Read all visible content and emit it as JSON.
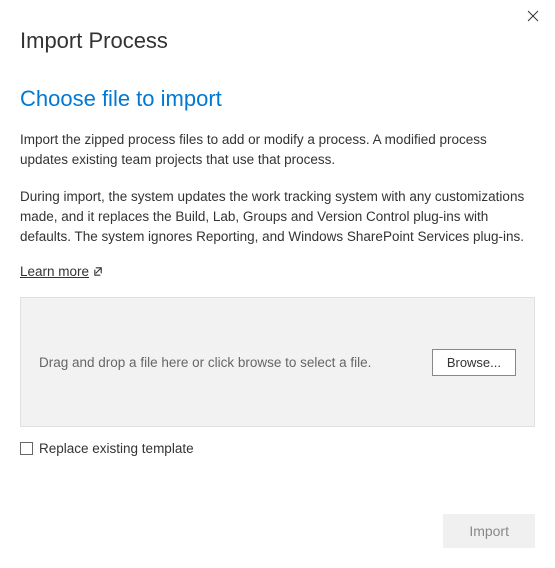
{
  "title": "Import Process",
  "subtitle": "Choose file to import",
  "description1": "Import the zipped process files to add or modify a process. A modified process updates existing team projects that use that process.",
  "description2": "During import, the system updates the work tracking system with any customizations made, and it replaces the Build, Lab, Groups and Version Control plug-ins with defaults. The system ignores Reporting, and Windows SharePoint Services plug-ins.",
  "learn_more": "Learn more",
  "drop_zone_text": "Drag and drop a file here or click browse to select a file.",
  "browse_label": "Browse...",
  "checkbox_label": "Replace existing template",
  "checkbox_checked": false,
  "import_label": "Import",
  "import_enabled": false
}
